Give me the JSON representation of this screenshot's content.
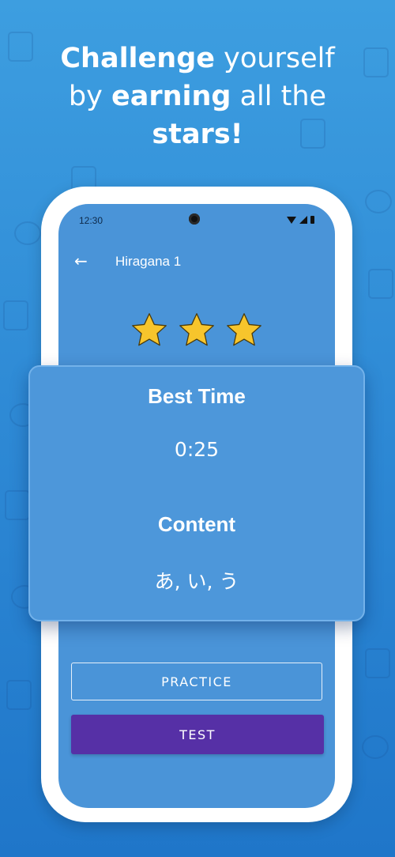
{
  "promo": {
    "line1_bold": "Challenge",
    "line1_light": " yourself",
    "line2_light_a": "by ",
    "line2_bold": "earning",
    "line2_light_b": " all the",
    "line3_bold": "stars!"
  },
  "status_bar": {
    "time": "12:30"
  },
  "app_bar": {
    "title": "Hiragana 1"
  },
  "stars": {
    "earned": 3,
    "total": 3,
    "color": "#f7c52c"
  },
  "card": {
    "best_time_label": "Best Time",
    "best_time_value": "0:25",
    "content_label": "Content",
    "content_value": "あ, い, う"
  },
  "buttons": {
    "practice": "PRACTICE",
    "test": "TEST"
  },
  "colors": {
    "background": "#2f8bd6",
    "screen": "#4a94d8",
    "test_button": "#5630a6"
  }
}
